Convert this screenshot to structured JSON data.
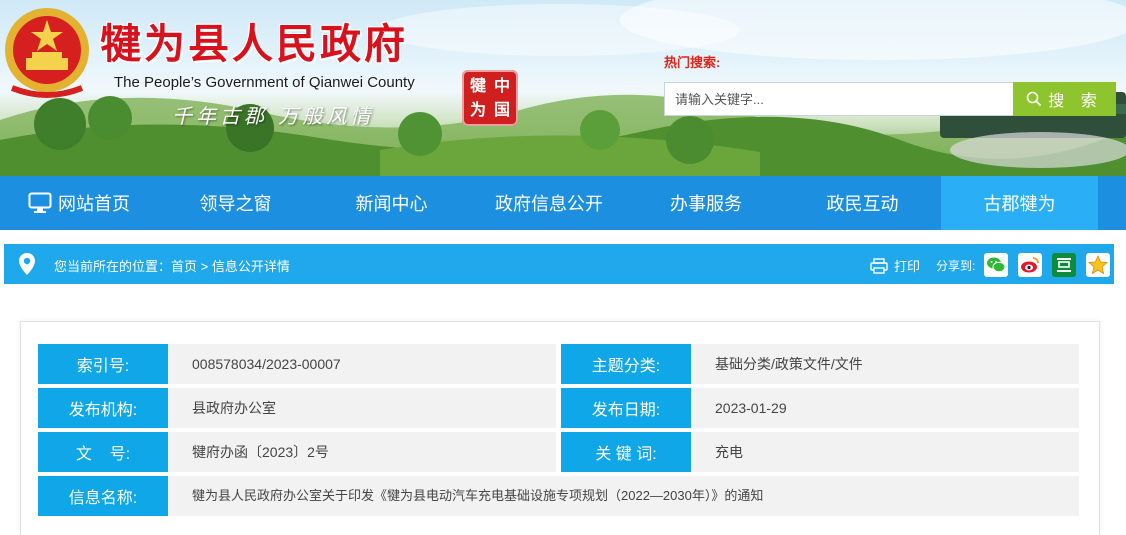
{
  "header": {
    "title": "犍为县人民政府",
    "subtitle": "The People’s Government of Qianwei County",
    "slogan": "千年古郡 万般风情",
    "seal_chars": [
      "犍",
      "中",
      "为",
      "国"
    ],
    "hot_search_label": "热门搜索:",
    "search_placeholder": "请输入关键字...",
    "search_button": "搜 索"
  },
  "nav": {
    "items": [
      {
        "label": "网站首页",
        "icon": "monitor-icon"
      },
      {
        "label": "领导之窗"
      },
      {
        "label": "新闻中心"
      },
      {
        "label": "政府信息公开"
      },
      {
        "label": "办事服务"
      },
      {
        "label": "政民互动"
      },
      {
        "label": "古郡犍为",
        "active": true
      }
    ]
  },
  "breadcrumb": {
    "prefix": "您当前所在的位置：",
    "home": "首页",
    "separator": " > ",
    "current": "信息公开详情",
    "print_label": "打印",
    "share_label": "分享到:",
    "share_icons": [
      "wechat-icon",
      "weibo-icon",
      "douban-icon",
      "qzone-icon"
    ]
  },
  "info": {
    "index_label": "索引号:",
    "index_value": "008578034/2023-00007",
    "topic_label": "主题分类:",
    "topic_value": "基础分类/政策文件/文件",
    "org_label": "发布机构:",
    "org_value": "县政府办公室",
    "date_label": "发布日期:",
    "date_value": "2023-01-29",
    "docno_label": "文    号:",
    "docno_value": "犍府办函〔2023〕2号",
    "keyword_label": "关 键 词:",
    "keyword_value": "充电",
    "name_label": "信息名称:",
    "name_value": "犍为县人民政府办公室关于印发《犍为县电动汽车充电基础设施专项规划（2022—2030年）》的通知"
  },
  "colors": {
    "nav_bg": "#1d8fe0",
    "nav_active": "#2aaef5",
    "label_bg": "#10a7e8",
    "title_red": "#d8121d",
    "search_green": "#8ec52f"
  }
}
